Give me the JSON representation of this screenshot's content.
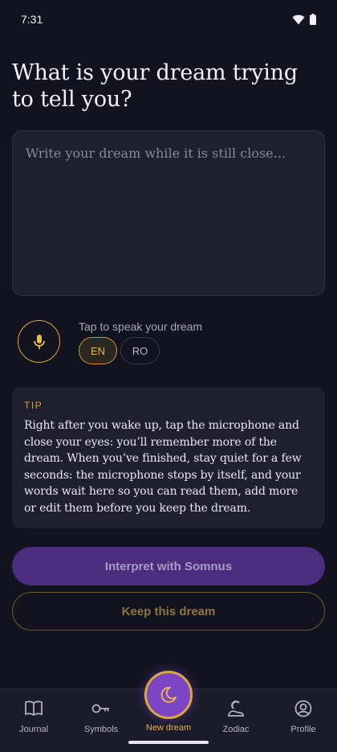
{
  "status_bar": {
    "time": "7:31"
  },
  "heading": "What is your dream trying to tell you?",
  "dream_input": {
    "placeholder": "Write your dream while it is still close...",
    "value": ""
  },
  "voice": {
    "label": "Tap to speak your dream",
    "languages": [
      {
        "code": "EN",
        "selected": true
      },
      {
        "code": "RO",
        "selected": false
      }
    ]
  },
  "tip": {
    "label": "TIP",
    "text": "Right after you wake up, tap the microphone and close your eyes: you’ll remember more of the dream. When you’ve finished, stay quiet for a few seconds: the microphone stops by itself, and your words wait here so you can read them, add more or edit them before you keep the dream."
  },
  "actions": {
    "interpret_label": "Interpret with Somnus",
    "keep_label": "Keep this dream"
  },
  "nav": {
    "items": [
      {
        "label": "Journal",
        "icon": "book-icon"
      },
      {
        "label": "Symbols",
        "icon": "key-icon"
      },
      {
        "label": "New dream",
        "icon": "moon-icon"
      },
      {
        "label": "Zodiac",
        "icon": "zodiac-icon"
      },
      {
        "label": "Profile",
        "icon": "profile-icon"
      }
    ]
  },
  "colors": {
    "background": "#13131f",
    "surface": "#1f1f30",
    "accent_gold": "#d8a93e",
    "accent_purple": "#7b45c4",
    "button_purple": "#4b2d7e"
  }
}
